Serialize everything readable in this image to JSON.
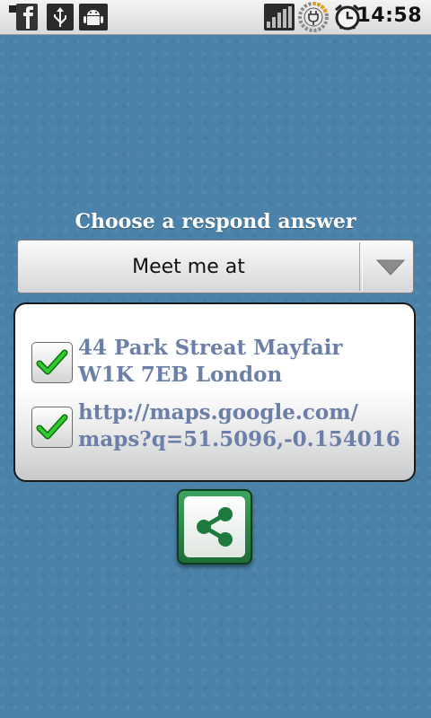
{
  "status_bar": {
    "time": "14:58",
    "left_icons": [
      "facebook-notification-icon",
      "usb-icon",
      "android-debug-icon"
    ],
    "right_icons": [
      "signal-icon",
      "battery-charging-icon",
      "alarm-clock-icon"
    ]
  },
  "prompt": "Choose a respond answer",
  "spinner": {
    "selected": "Meet me at"
  },
  "panel": {
    "items": [
      {
        "checked": true,
        "line1": "44 Park Streat Mayfair",
        "line2": "W1K 7EB London"
      },
      {
        "checked": true,
        "line1": "http://maps.google.com/",
        "line2": "maps?q=51.5096,-0.154016"
      }
    ]
  },
  "share_button": {
    "icon": "share-icon"
  },
  "colors": {
    "background": "#4b82a9",
    "item_text": "#6b7fa8",
    "share_green": "#2e8b4f",
    "check_green": "#22b022"
  }
}
